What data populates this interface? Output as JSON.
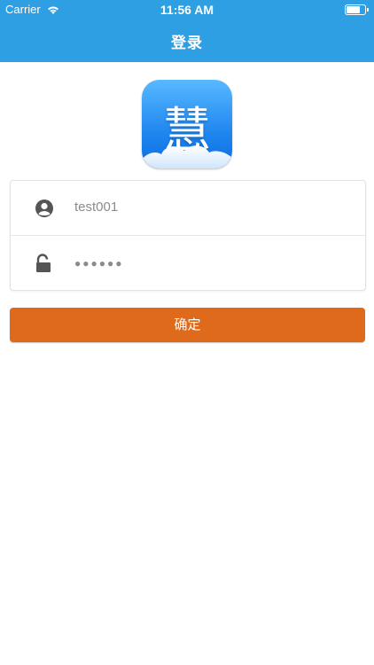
{
  "status_bar": {
    "carrier": "Carrier",
    "time": "11:56 AM",
    "battery_level": 0.7
  },
  "nav": {
    "title": "登录"
  },
  "logo": {
    "glyph": "慧"
  },
  "form": {
    "username_value": "test001",
    "password_mask": "●●●●●●"
  },
  "actions": {
    "confirm_label": "确定"
  },
  "colors": {
    "nav_bar": "#2f9fe3",
    "confirm_button": "#e06a1b",
    "icon": "#555555"
  },
  "icons": {
    "username": "user-icon",
    "password": "unlock-icon",
    "wifi": "wifi-icon",
    "battery": "battery-icon"
  }
}
